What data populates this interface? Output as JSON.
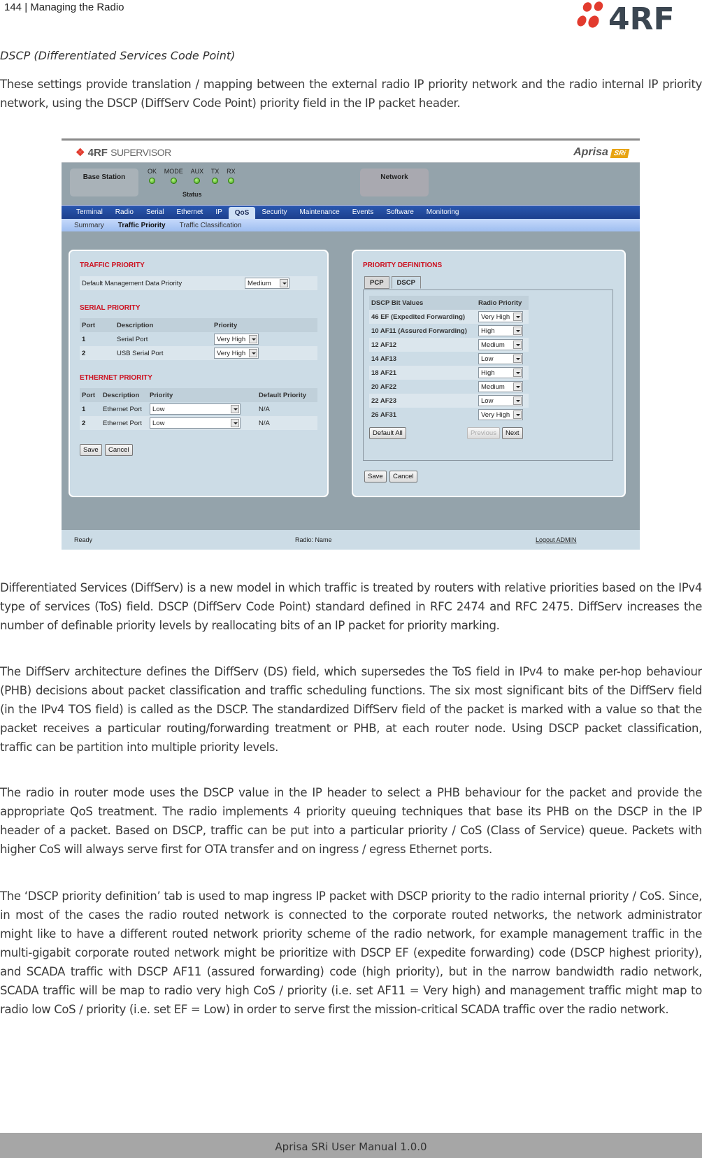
{
  "page": {
    "header": "144  |  Managing the Radio",
    "logo_text": "4RF",
    "section_title": "DSCP (Differentiated Services Code Point)",
    "intro": "These settings provide translation / mapping between the external radio IP priority network and the radio internal IP priority network, using the DSCP (DiffServ Code Point) priority field in the IP packet header.",
    "paragraphs": [
      "Differentiated Services (DiffServ) is a new model in which traffic is treated by routers with relative priorities based on the IPv4 type of services (ToS) field. DSCP (DiffServ Code Point) standard defined in RFC 2474 and RFC 2475. DiffServ increases the number of definable priority levels by reallocating bits of an IP packet for priority marking.",
      "The DiffServ architecture defines the DiffServ (DS) field, which supersedes the ToS field in IPv4 to make per-hop behaviour (PHB) decisions about packet classification and traffic scheduling functions. The six most significant bits of the DiffServ field (in the IPv4 TOS field) is called as the DSCP. The standardized DiffServ field of the packet is marked with a value so that the packet receives a particular routing/forwarding treatment or PHB, at each router node. Using DSCP packet classification, traffic can be partition into multiple priority levels.",
      "The radio in router mode uses the DSCP value in the IP header to select a PHB behaviour for the packet and provide the appropriate QoS treatment. The radio implements 4 priority queuing techniques that base its PHB on the DSCP in the IP header of a packet. Based on DSCP, traffic can be put into a particular priority / CoS (Class of Service) queue. Packets with higher CoS will always serve first for OTA transfer and on ingress / egress Ethernet ports.",
      "The ‘DSCP priority definition’ tab is used to map ingress IP packet with DSCP priority to the radio internal priority / CoS. Since, in most of the cases the radio routed network is connected to the corporate routed networks, the network administrator might like to have a different routed network priority scheme of the radio network, for example management traffic in the multi-gigabit corporate routed network might be prioritize with DSCP EF (expedite forwarding) code (DSCP highest priority), and SCADA traffic with DSCP AF11 (assured forwarding) code (high priority), but in the narrow bandwidth radio network, SCADA traffic will be map to radio very high CoS / priority (i.e. set AF11 = Very high) and management traffic might map to radio low CoS / priority (i.e. set EF = Low)  in order to serve first the mission-critical SCADA traffic over the radio network."
    ],
    "footer": "Aprisa SRi User Manual 1.0.0"
  },
  "app": {
    "brand": "4RF",
    "brand_product": "SUPERVISOR",
    "aprisa": "Aprisa",
    "aprisa_badge": "SRi",
    "station": "Base Station",
    "network": "Network",
    "leds": [
      "OK",
      "MODE",
      "AUX",
      "TX",
      "RX"
    ],
    "status_label": "Status",
    "nav": [
      "Terminal",
      "Radio",
      "Serial",
      "Ethernet",
      "IP",
      "QoS",
      "Security",
      "Maintenance",
      "Events",
      "Software",
      "Monitoring"
    ],
    "nav_active": "QoS",
    "subnav": [
      "Summary",
      "Traffic Priority",
      "Traffic Classification"
    ],
    "subnav_active": "Traffic Priority",
    "traffic_priority": {
      "title": "TRAFFIC PRIORITY",
      "label": "Default Management Data Priority",
      "value": "Medium"
    },
    "serial_priority": {
      "title": "SERIAL PRIORITY",
      "headers": [
        "Port",
        "Description",
        "Priority"
      ],
      "rows": [
        {
          "port": "1",
          "description": "Serial Port",
          "priority": "Very High"
        },
        {
          "port": "2",
          "description": "USB Serial Port",
          "priority": "Very High"
        }
      ]
    },
    "ethernet_priority": {
      "title": "ETHERNET PRIORITY",
      "headers": [
        "Port",
        "Description",
        "Priority",
        "Default Priority"
      ],
      "rows": [
        {
          "port": "1",
          "description": "Ethernet Port",
          "priority": "Low",
          "default": "N/A"
        },
        {
          "port": "2",
          "description": "Ethernet Port",
          "priority": "Low",
          "default": "N/A"
        }
      ]
    },
    "save": "Save",
    "cancel": "Cancel",
    "priority_definitions": {
      "title": "PRIORITY DEFINITIONS",
      "tabs": [
        "PCP",
        "DSCP"
      ],
      "active_tab": "DSCP",
      "headers": [
        "DSCP Bit Values",
        "Radio Priority"
      ],
      "rows": [
        {
          "bits": "46 EF (Expedited Forwarding)",
          "priority": "Very High"
        },
        {
          "bits": "10 AF11 (Assured Forwarding)",
          "priority": "High"
        },
        {
          "bits": "12 AF12",
          "priority": "Medium"
        },
        {
          "bits": "14 AF13",
          "priority": "Low"
        },
        {
          "bits": "18 AF21",
          "priority": "High"
        },
        {
          "bits": "20 AF22",
          "priority": "Medium"
        },
        {
          "bits": "22 AF23",
          "priority": "Low"
        },
        {
          "bits": "26 AF31",
          "priority": "Very High"
        }
      ],
      "default_all": "Default All",
      "previous": "Previous",
      "next": "Next"
    },
    "footer": {
      "status": "Ready",
      "radio": "Radio: Name",
      "logout": "Logout ADMIN"
    }
  }
}
